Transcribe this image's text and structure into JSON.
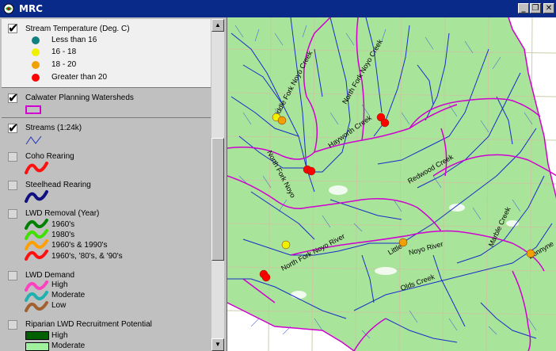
{
  "window": {
    "title": "MRC"
  },
  "legend": {
    "stream_temp": {
      "name": "Stream Temperature (Deg. C)",
      "classes": [
        {
          "label": "Less than 16",
          "color": "#108080"
        },
        {
          "label": "16 - 18",
          "color": "#f0f000"
        },
        {
          "label": "18 - 20",
          "color": "#f0a000"
        },
        {
          "label": "Greater than 20",
          "color": "#ff0000"
        }
      ]
    },
    "watersheds": {
      "name": "Calwater Planning Watersheds",
      "color": "#d000d0"
    },
    "streams": {
      "name": "Streams (1:24k)",
      "color": "#2030c0"
    },
    "coho": {
      "name": "Coho Rearing",
      "color": "#ff1010"
    },
    "steelhead": {
      "name": "Steelhead Rearing",
      "color": "#101080"
    },
    "lwd_removal": {
      "name": "LWD Removal (Year)",
      "classes": [
        {
          "label": "1960's",
          "color": "#008000"
        },
        {
          "label": "1980's",
          "color": "#40e000"
        },
        {
          "label": "1960's & 1990's",
          "color": "#ffa000"
        },
        {
          "label": "1960's, '80's, & '90's",
          "color": "#ff1010"
        }
      ]
    },
    "lwd_demand": {
      "name": "LWD Demand",
      "classes": [
        {
          "label": "High",
          "color": "#ff40c0"
        },
        {
          "label": "Moderate",
          "color": "#20b0b0"
        },
        {
          "label": "Low",
          "color": "#a06030"
        }
      ]
    },
    "riparian": {
      "name": "Riparian LWD Recruitment Potential",
      "classes": [
        {
          "label": "High",
          "color": "#006000"
        },
        {
          "label": "Moderate",
          "color": "#a0f0a0"
        }
      ]
    }
  },
  "map": {
    "labels": [
      {
        "text": "Middle Fork Noyo Creek"
      },
      {
        "text": "North Fork Noyo Creek"
      },
      {
        "text": "Hayworth Creek"
      },
      {
        "text": "North Fork Noyo"
      },
      {
        "text": "Redwood Creek"
      },
      {
        "text": "North Fork Noyo River"
      },
      {
        "text": "Olds Creek"
      },
      {
        "text": "Little"
      },
      {
        "text": "Noyo River"
      },
      {
        "text": "Marble Creek"
      },
      {
        "text": "Bonnyne"
      }
    ]
  }
}
